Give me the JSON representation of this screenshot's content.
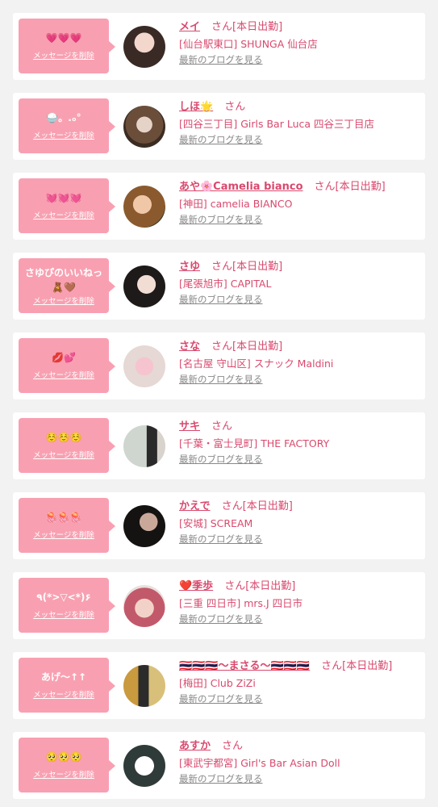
{
  "favorites": [
    {
      "message": "💗💗💗",
      "delete_label": "メッセージを削除",
      "name": "メイ",
      "san": "さん",
      "today": "[本日出勤]",
      "shop": "[仙台駅東口] SHUNGA 仙台店",
      "blog_link": "最新のブログを見る"
    },
    {
      "message": "🍚。.ₒ°",
      "delete_label": "メッセージを削除",
      "name": "しほ🌟",
      "san": "さん",
      "today": "",
      "shop": "[四谷三丁目] Girls Bar Luca 四谷三丁目店",
      "blog_link": "最新のブログを見る"
    },
    {
      "message": "💓💓💓",
      "delete_label": "メッセージを削除",
      "name": "あや🌸Camelia bianco",
      "san": "さん",
      "today": "[本日出勤]",
      "shop": "[神田] camelia BIANCO",
      "blog_link": "最新のブログを見る"
    },
    {
      "message": "さゆぴのいいねっ",
      "message2": "🧸🤎",
      "delete_label": "メッセージを削除",
      "name": "さゆ",
      "san": "さん",
      "today": "[本日出勤]",
      "shop": "[尾張旭市] CAPITAL",
      "blog_link": "最新のブログを見る"
    },
    {
      "message": "💋💕",
      "delete_label": "メッセージを削除",
      "name": "さな",
      "san": "さん",
      "today": "[本日出勤]",
      "shop": "[名古屋 守山区] スナック Maldini",
      "blog_link": "最新のブログを見る"
    },
    {
      "message": "☺️☺️☺️",
      "delete_label": "メッセージを削除",
      "name": "サキ",
      "san": "さん",
      "today": "",
      "shop": "[千葉・富士見町] THE FACTORY",
      "blog_link": "最新のブログを見る"
    },
    {
      "message": "🪼🪼🪼",
      "delete_label": "メッセージを削除",
      "name": "かえで",
      "san": "さん",
      "today": "[本日出勤]",
      "shop": "[安城] SCREAM",
      "blog_link": "最新のブログを見る"
    },
    {
      "message": "٩(*>▽<*)۶",
      "delete_label": "メッセージを削除",
      "name": "❤️季歩",
      "san": "さん",
      "today": "[本日出勤]",
      "shop": "[三重 四日市] mrs.J 四日市",
      "blog_link": "最新のブログを見る"
    },
    {
      "message": "あげ〜↑↑",
      "delete_label": "メッセージを削除",
      "name": "🇹🇭🇹🇭🇹🇭〜まさる〜🇹🇭🇹🇭🇹🇭",
      "san": "さん",
      "today": "[本日出勤]",
      "shop": "[梅田] Club ZiZi",
      "blog_link": "最新のブログを見る"
    },
    {
      "message": "🥺🥺🥺",
      "delete_label": "メッセージを削除",
      "name": "あすか",
      "san": "さん",
      "today": "",
      "shop": "[東武宇都宮] Girl's Bar Asian Doll",
      "blog_link": "最新のブログを見る"
    }
  ],
  "colors": {
    "page_bg": "#f2f2f2",
    "bubble": "#f8a0b1",
    "accent": "#d9496e",
    "muted": "#888888"
  }
}
